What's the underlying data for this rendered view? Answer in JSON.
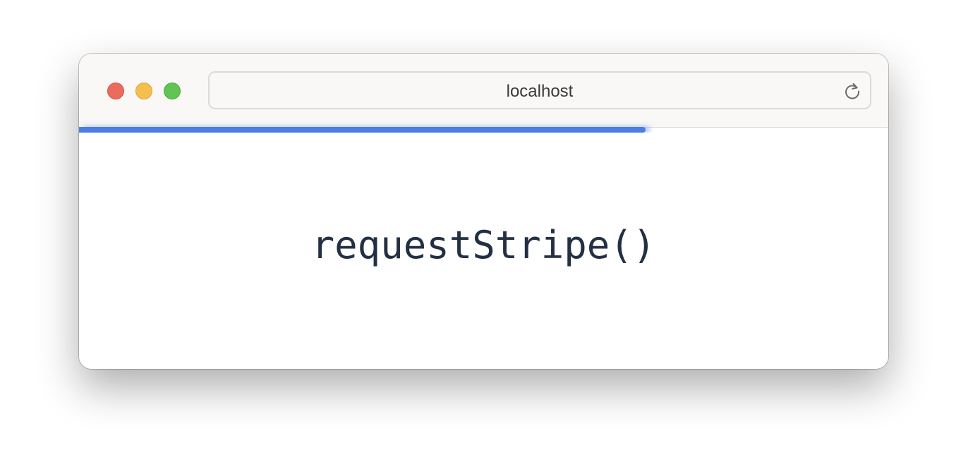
{
  "browser": {
    "url": "localhost",
    "page_load_progress": 0.7,
    "colors": {
      "accent": "#4a7ee3",
      "close": "#ed6a5e",
      "minimize": "#f5bf4f",
      "maximize": "#61c554"
    }
  },
  "page": {
    "code_label": "requestStripe()"
  },
  "icons": {
    "reload": "reload-icon"
  }
}
